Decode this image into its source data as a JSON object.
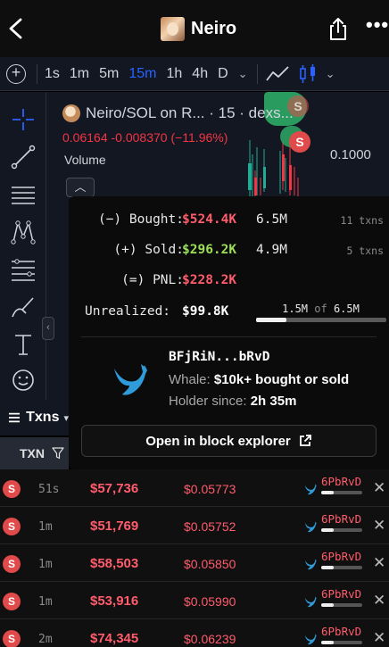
{
  "header": {
    "title": "Neiro"
  },
  "toolbar": {
    "timeframes": [
      "1s",
      "1m",
      "5m",
      "15m",
      "1h",
      "4h",
      "D"
    ],
    "active_timeframe": "15m",
    "dropdown_glyph": "⌄"
  },
  "chart": {
    "symbol": "Neiro/SOL on R... · 15 · dexs...",
    "ohlc": "0.06164  -0.008370 (−11.96%)",
    "volume_label": "Volume",
    "price_level": "0.1000",
    "marker": "S"
  },
  "popup": {
    "bought_label": "(−) Bought:",
    "bought_usd": "$524.4K",
    "bought_amount": "6.5M",
    "bought_txns": "11 txns",
    "sold_label": "(+) Sold:",
    "sold_usd": "$296.2K",
    "sold_amount": "4.9M",
    "sold_txns": "5 txns",
    "pnl_label": "(=) PNL:",
    "pnl_usd": "$228.2K",
    "unrealized_label": "Unrealized:",
    "unrealized_usd": "$99.8K",
    "holding_amount": "1.5M",
    "holding_of": "of",
    "holding_total": "6.5M",
    "holding_fraction": 0.23,
    "address": "BFjRiN...bRvD",
    "whale_label": "Whale:",
    "whale_value": "$10k+ bought or sold",
    "holder_label": "Holder since:",
    "holder_value": "2h 35m",
    "explorer_button": "Open in block explorer"
  },
  "txns": {
    "tab_label": "Txns",
    "column_txn": "TXN",
    "rows": [
      {
        "type": "S",
        "age": "51s",
        "usd": "$57,736",
        "price": "$0.05773",
        "maker": "6PbRvD",
        "fraction": 0.3
      },
      {
        "type": "S",
        "age": "1m",
        "usd": "$51,769",
        "price": "$0.05752",
        "maker": "6PbRvD",
        "fraction": 0.3
      },
      {
        "type": "S",
        "age": "1m",
        "usd": "$58,503",
        "price": "$0.05850",
        "maker": "6PbRvD",
        "fraction": 0.3
      },
      {
        "type": "S",
        "age": "1m",
        "usd": "$53,916",
        "price": "$0.05990",
        "maker": "6PbRvD",
        "fraction": 0.3
      },
      {
        "type": "S",
        "age": "2m",
        "usd": "$74,345",
        "price": "$0.06239",
        "maker": "6PbRvD",
        "fraction": 0.3
      }
    ]
  },
  "colors": {
    "sell": "#ff5c6c",
    "buy": "#9ce05a",
    "accent": "#2962ff",
    "whale": "#2f9bd9"
  }
}
